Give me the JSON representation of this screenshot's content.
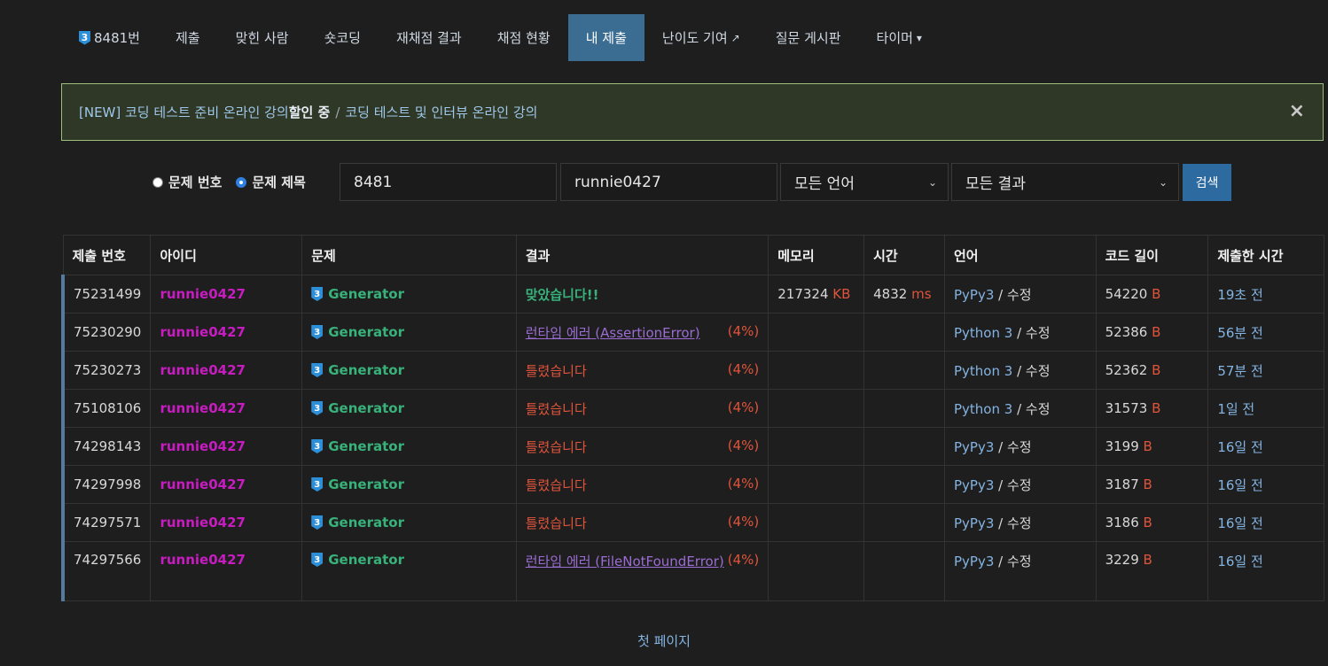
{
  "nav": {
    "problem_tier": "3",
    "items": [
      {
        "label": "8481번"
      },
      {
        "label": "제출"
      },
      {
        "label": "맞힌 사람"
      },
      {
        "label": "숏코딩"
      },
      {
        "label": "재채점 결과"
      },
      {
        "label": "채점 현황"
      },
      {
        "label": "내 제출"
      },
      {
        "label": "난이도 기여"
      },
      {
        "label": "질문 게시판"
      },
      {
        "label": "타이머"
      }
    ],
    "active_index": 6
  },
  "alert": {
    "prefix": "[NEW] 코딩 테스트 준비 온라인 강의 ",
    "bold": "할인 중",
    "sep": "/",
    "suffix": "코딩 테스트 및 인터뷰 온라인 강의",
    "close": "×"
  },
  "search": {
    "radio_number_label": "문제 번호",
    "radio_title_label": "문제 제목",
    "selected_radio": "title",
    "problem_value": "8481",
    "user_value": "runnie0427",
    "language_select": "모든 언어",
    "result_select": "모든 결과",
    "button": "검색"
  },
  "table": {
    "headers": [
      "제출 번호",
      "아이디",
      "문제",
      "결과",
      "메모리",
      "시간",
      "언어",
      "코드 길이",
      "제출한 시간"
    ],
    "rows": [
      {
        "id": "75231499",
        "user": "runnie0427",
        "problem": "Generator",
        "result": "맞았습니다!!",
        "result_type": "ac",
        "pct": "",
        "memory": "217324",
        "memory_unit": "KB",
        "time": "4832",
        "time_unit": "ms",
        "lang": "PyPy3",
        "edit": "수정",
        "length": "54220",
        "length_unit": "B",
        "ago": "19초 전"
      },
      {
        "id": "75230290",
        "user": "runnie0427",
        "problem": "Generator",
        "result": "런타임 에러 (AssertionError)",
        "result_type": "re",
        "pct": "(4%)",
        "memory": "",
        "memory_unit": "",
        "time": "",
        "time_unit": "",
        "lang": "Python 3",
        "edit": "수정",
        "length": "52386",
        "length_unit": "B",
        "ago": "56분 전"
      },
      {
        "id": "75230273",
        "user": "runnie0427",
        "problem": "Generator",
        "result": "틀렸습니다",
        "result_type": "wa",
        "pct": "(4%)",
        "memory": "",
        "memory_unit": "",
        "time": "",
        "time_unit": "",
        "lang": "Python 3",
        "edit": "수정",
        "length": "52362",
        "length_unit": "B",
        "ago": "57분 전"
      },
      {
        "id": "75108106",
        "user": "runnie0427",
        "problem": "Generator",
        "result": "틀렸습니다",
        "result_type": "wa",
        "pct": "(4%)",
        "memory": "",
        "memory_unit": "",
        "time": "",
        "time_unit": "",
        "lang": "Python 3",
        "edit": "수정",
        "length": "31573",
        "length_unit": "B",
        "ago": "1일 전"
      },
      {
        "id": "74298143",
        "user": "runnie0427",
        "problem": "Generator",
        "result": "틀렸습니다",
        "result_type": "wa",
        "pct": "(4%)",
        "memory": "",
        "memory_unit": "",
        "time": "",
        "time_unit": "",
        "lang": "PyPy3",
        "edit": "수정",
        "length": "3199",
        "length_unit": "B",
        "ago": "16일 전"
      },
      {
        "id": "74297998",
        "user": "runnie0427",
        "problem": "Generator",
        "result": "틀렸습니다",
        "result_type": "wa",
        "pct": "(4%)",
        "memory": "",
        "memory_unit": "",
        "time": "",
        "time_unit": "",
        "lang": "PyPy3",
        "edit": "수정",
        "length": "3187",
        "length_unit": "B",
        "ago": "16일 전"
      },
      {
        "id": "74297571",
        "user": "runnie0427",
        "problem": "Generator",
        "result": "틀렸습니다",
        "result_type": "wa",
        "pct": "(4%)",
        "memory": "",
        "memory_unit": "",
        "time": "",
        "time_unit": "",
        "lang": "PyPy3",
        "edit": "수정",
        "length": "3186",
        "length_unit": "B",
        "ago": "16일 전"
      },
      {
        "id": "74297566",
        "user": "runnie0427",
        "problem": "Generator",
        "result": "런타임 에러 (FileNotFoundError)",
        "result_type": "re",
        "pct": "(4%)",
        "memory": "",
        "memory_unit": "",
        "time": "",
        "time_unit": "",
        "lang": "PyPy3",
        "edit": "수정",
        "length": "3229",
        "length_unit": "B",
        "ago": "16일 전"
      }
    ]
  },
  "pagination": {
    "first_page": "첫 페이지"
  },
  "colors": {
    "accent": "#3b6d93",
    "user": "#c61cc0",
    "accepted": "#38b27a",
    "wrong": "#e0543c",
    "runtime_error": "#9b6cd2",
    "link": "#84b4e2"
  }
}
